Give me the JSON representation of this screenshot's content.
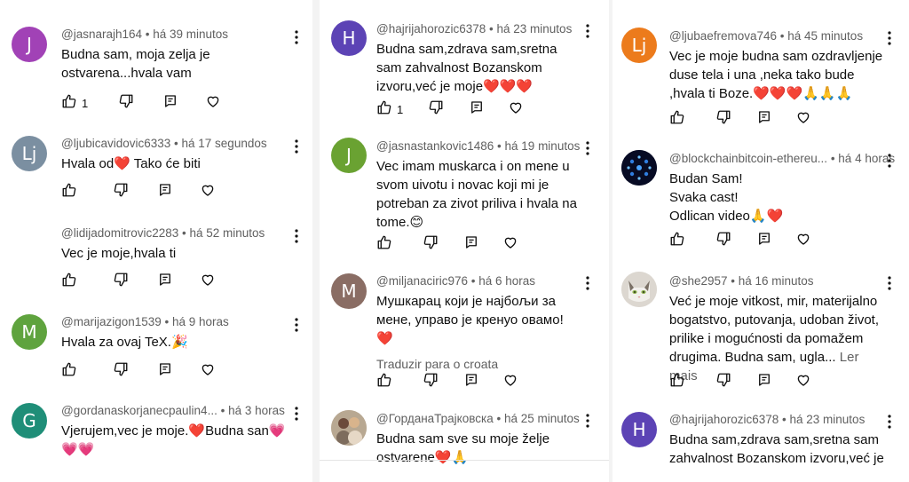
{
  "labels": {
    "translate": "Traduzir para o croata",
    "read_more": "Ler mais"
  },
  "col1": [
    {
      "handle": "@jasnarajh164",
      "time": "há 39 minutos",
      "initial": "J",
      "avatar_color": "#a142b6",
      "text": "Budna sam, moja zelja je ostvarena...hvala vam",
      "likes": "1"
    },
    {
      "handle": "@ljubicavidovic6333",
      "time": "há 17 segundos",
      "initial": "Lj",
      "avatar_color": "#7b8fa1",
      "text_pre": "Hvala od",
      "text_post": " Tako će biti"
    },
    {
      "handle": "@lidijadomitrovic2283",
      "time": "há 52 minutos",
      "text": "Vec je moje,hvala ti"
    },
    {
      "handle": "@marijazigon1539",
      "time": "há 9 horas",
      "initial": "M",
      "avatar_color": "#5fa33e",
      "text": "Hvala za ovaj TeX.🎉"
    },
    {
      "handle": "@gordanaskorjanecpaulin4...",
      "time": "há 3 horas",
      "initial": "G",
      "avatar_color": "#1f8e78",
      "text": "Vjerujem,vec je moje.❤️Budna san💗 💗💗"
    }
  ],
  "col2": [
    {
      "handle": "@hajrijahorozic6378",
      "time": "há 23 minutos",
      "initial": "H",
      "avatar_color": "#5c43b5",
      "text": "Budna sam,zdrava sam,sretna sam zahvalnost Bozanskom izvoru,već je moje❤️❤️❤️",
      "likes": "1"
    },
    {
      "handle": "@jasnastankovic1486",
      "time": "há 19 minutos",
      "initial": "J",
      "avatar_color": "#6aa232",
      "text": "Vec imam muskarca i on mene u svom uivotu i novac koji mi je potreban za zivot priliva i hvala na tome.😊"
    },
    {
      "handle": "@miljanaciric976",
      "time": "há 6 horas",
      "initial": "M",
      "avatar_color": "#8a6d64",
      "text": "Мушкарац који је најбољи за мене, управо је кренуо овамо! ❤️"
    },
    {
      "handle": "@ГорданаТрајковска",
      "time": "há 25 minutos",
      "text": "Budna sam sve su moje želje ostvarene❤️🙏"
    }
  ],
  "col3": [
    {
      "handle": "@ljubaefremova746",
      "time": "há 45 minutos",
      "initial": "Lj",
      "avatar_color": "#ec7b1c",
      "text": "Vec je moje  budna sam ozdravljenje duse tela i una ,neka tako bude ,hvala ti Boze.❤️❤️❤️🙏🙏🙏"
    },
    {
      "handle": "@blockchainbitcoin-ethereu...",
      "time": "há 4 horas",
      "lines": [
        "Budan Sam!",
        "Svaka cast!",
        "Odlican video🙏❤️"
      ]
    },
    {
      "handle": "@she2957",
      "time": "há 16 minutos",
      "text": "Već je moje vitkost, mir, materijalno bogatstvo, putovanja, udoban život, prilike i mogućnosti da pomažem drugima. Budna sam, ugla..."
    },
    {
      "handle": "@hajrijahorozic6378",
      "time": "há 23 minutos",
      "initial": "H",
      "avatar_color": "#5c43b5",
      "text": "Budna sam,zdrava sam,sretna sam zahvalnost Bozanskom izvoru,već je"
    }
  ]
}
